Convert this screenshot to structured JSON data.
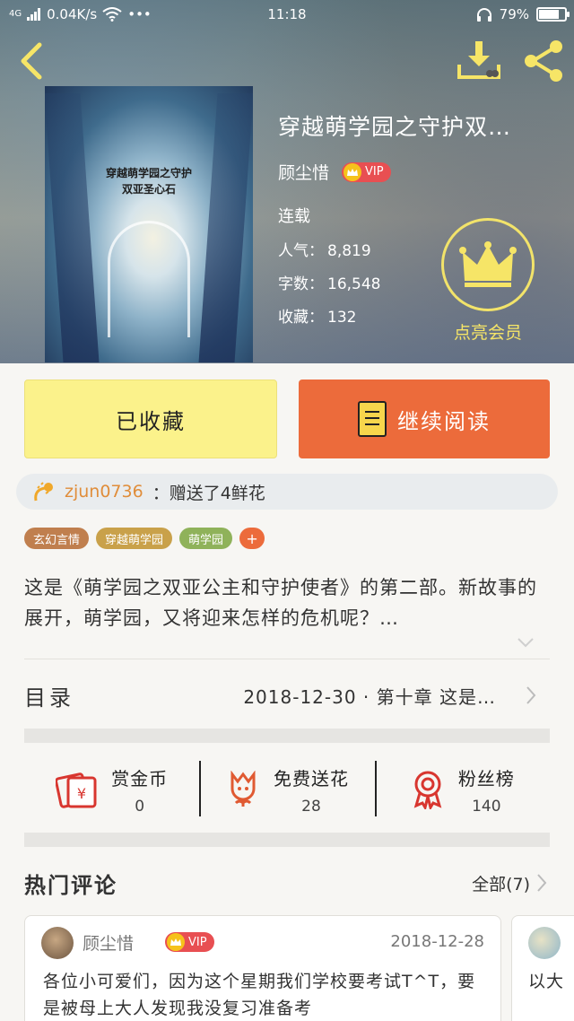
{
  "status_bar": {
    "network": "4G",
    "speed": "0.04K/s",
    "dots": "•••",
    "time": "11:18",
    "battery": "79%",
    "battery_level": 0.79
  },
  "book": {
    "cover_title_line1": "穿越萌学园之守护",
    "cover_title_line2": "双亚圣心石",
    "title": "穿越萌学园之守护双…",
    "author": "顾尘惜",
    "vip": "VIP",
    "status": "连载",
    "stats": [
      {
        "label": "人气：",
        "value": "8,819"
      },
      {
        "label": "字数：",
        "value": "16,548"
      },
      {
        "label": "收藏：",
        "value": "132"
      }
    ],
    "member_label": "点亮会员"
  },
  "actions": {
    "collected": "已收藏",
    "continue_reading": "继续阅读"
  },
  "gift_notice": {
    "user": "zjun0736",
    "message": "：赠送了4鲜花"
  },
  "tags": [
    {
      "label": "玄幻言情",
      "color": "#c07f4e"
    },
    {
      "label": "穿越萌学园",
      "color": "#c9a14a"
    },
    {
      "label": "萌学园",
      "color": "#8fb25a"
    }
  ],
  "tag_add": "+",
  "description": "这是《萌学园之双亚公主和守护使者》的第二部。新故事的展开，萌学园，又将迎来怎样的危机呢？…",
  "toc": {
    "label": "目录",
    "latest": "2018-12-30 · 第十章 这是…"
  },
  "support": [
    {
      "title": "赏金币",
      "count": "0"
    },
    {
      "title": "免费送花",
      "count": "28"
    },
    {
      "title": "粉丝榜",
      "count": "140"
    }
  ],
  "comments_section": {
    "title": "热门评论",
    "all_label": "全部(7)"
  },
  "comments": [
    {
      "author": "顾尘惜",
      "vip": "VIP",
      "date": "2018-12-28",
      "text": "各位小可爱们，因为这个星期我们学校要考试T^T，要是被母上大人发现我没复习准备考"
    },
    {
      "text": "以大"
    }
  ],
  "colors": {
    "accent_orange": "#ec6b3b",
    "collected_yellow": "#fbf28b",
    "member_yellow": "#f2e36a",
    "vip_red": "#e84f52"
  }
}
